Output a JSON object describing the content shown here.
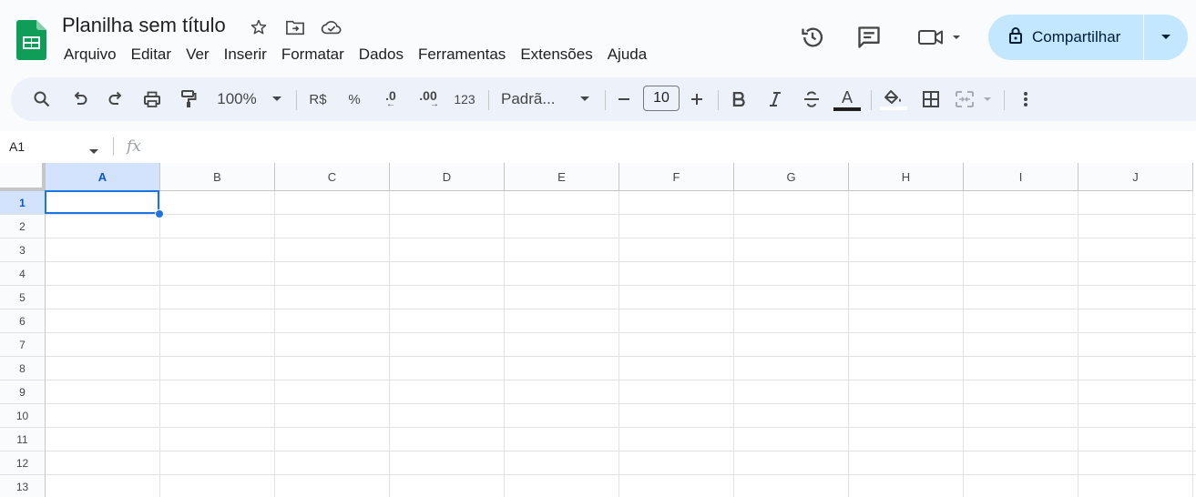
{
  "document": {
    "title": "Planilha sem título"
  },
  "menu": [
    "Arquivo",
    "Editar",
    "Ver",
    "Inserir",
    "Formatar",
    "Dados",
    "Ferramentas",
    "Extensões",
    "Ajuda"
  ],
  "share": {
    "label": "Compartilhar"
  },
  "toolbar": {
    "zoom": "100%",
    "currency": "R$",
    "percent": "%",
    "decrease_decimal": ".0",
    "increase_decimal": ".00",
    "number_format": "123",
    "font": "Padrã...",
    "font_size": "10",
    "text_color_glyph": "A"
  },
  "formula_bar": {
    "cell_ref": "A1",
    "fx": "fx",
    "value": ""
  },
  "grid": {
    "columns": [
      "A",
      "B",
      "C",
      "D",
      "E",
      "F",
      "G",
      "H",
      "I",
      "J"
    ],
    "rows": [
      "1",
      "2",
      "3",
      "4",
      "5",
      "6",
      "7",
      "8",
      "9",
      "10",
      "11",
      "12",
      "13"
    ],
    "selected_cell": "A1"
  },
  "colors": {
    "accent": "#1a73e8",
    "share_bg": "#c2e7ff",
    "logo": "#0f9d58"
  },
  "icons": [
    "sheets-logo-icon",
    "star-icon",
    "move-folder-icon",
    "cloud-saved-icon",
    "history-icon",
    "comments-icon",
    "meet-icon",
    "lock-icon",
    "chevron-down-icon",
    "search-icon",
    "undo-icon",
    "redo-icon",
    "print-icon",
    "paint-format-icon",
    "minus-icon",
    "plus-icon",
    "bold-icon",
    "italic-icon",
    "strikethrough-icon",
    "fill-color-icon",
    "borders-icon",
    "merge-cells-icon",
    "more-vert-icon"
  ]
}
